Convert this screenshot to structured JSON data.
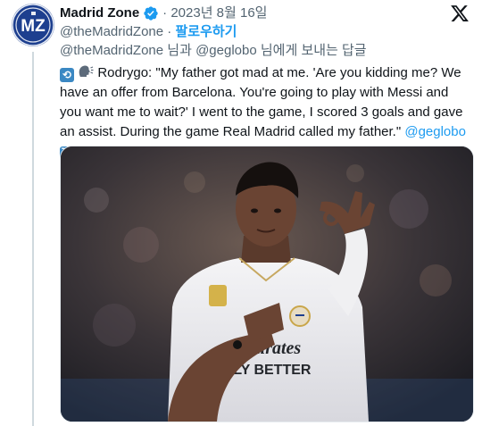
{
  "tweet": {
    "display_name": "Madrid Zone",
    "handle_line": "@theMadridZone",
    "date": "2023년 8월 16일",
    "separator": "·",
    "follow_label": "팔로우하기",
    "reply_to_handle_self": "@theMadridZone",
    "reply_word_1": "님과",
    "reply_to_handle_other": "@geglobo",
    "reply_word_2": "님에게 보내는 답글",
    "text_main": "Rodrygo: \"My father got mad at me. 'Are you kidding me? We have an offer from Barcelona. You're going to play with Messi and you want me to wait?' I went to the game, I scored 3 goals and gave an assist. During the game Real Madrid called my father.\"",
    "text_mention": "@geglobo",
    "avatar_initials": "MZ",
    "photo_jersey_text": "Emirates FLY BETTER"
  },
  "colors": {
    "link": "#1d9bf0",
    "muted": "#536471",
    "text": "#0f1419",
    "avatar_bg": "#1d3f8f"
  },
  "icons": {
    "verified": "verified-badge-icon",
    "platform": "x-logo-icon",
    "repeat_emoji": "repeat-arrow-emoji",
    "speaking_emoji": "speaking-head-emoji",
    "return_emoji": "right-arrow-curving-down-emoji"
  }
}
